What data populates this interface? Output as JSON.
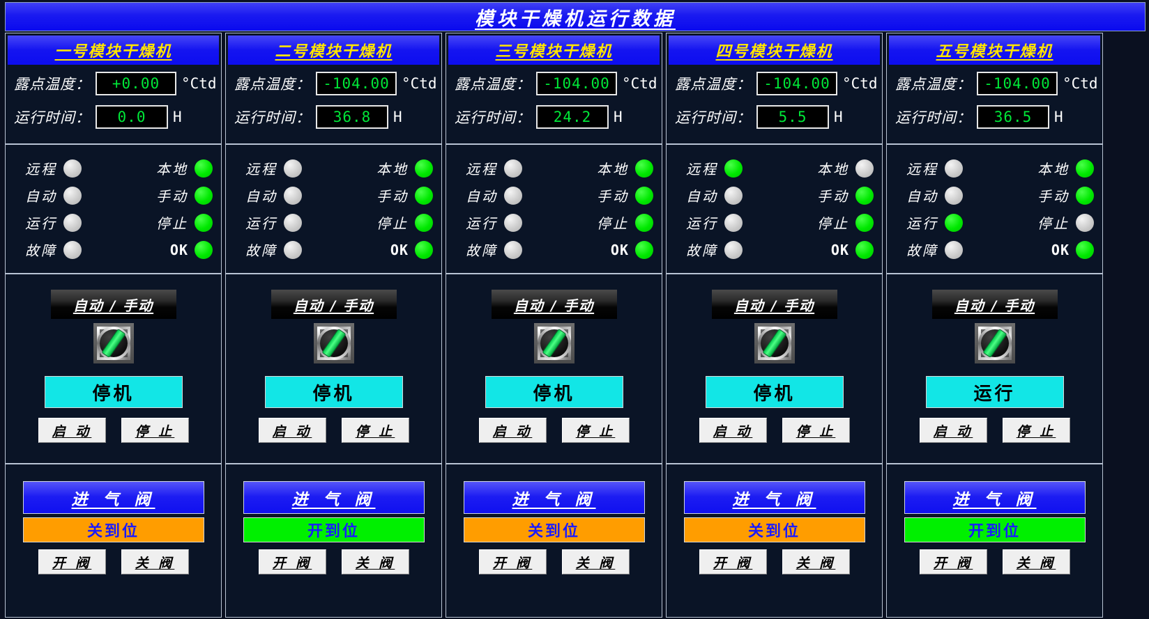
{
  "header": {
    "title": "模块干燥机运行数据"
  },
  "labels": {
    "dewpoint": "露点温度：",
    "dewpoint_unit": "°Ctd",
    "runtime": "运行时间：",
    "runtime_unit": "H",
    "remote": "远程",
    "local": "本地",
    "auto": "自动",
    "manual": "手动",
    "running": "运行",
    "stopped": "停止",
    "fault": "故障",
    "ok": "OK",
    "auto_manual_plate": "自动 / 手动",
    "start_button": "启 动",
    "stop_button": "停 止",
    "valve_title": "进 气 阀",
    "valve_open_button": "开 阀",
    "valve_close_button": "关 阀"
  },
  "colors": {
    "title_bar_blue": "#1414f0",
    "panel_header_yellow": "#ffe400",
    "led_on_green": "#00e800",
    "led_off_gray": "#c9c9c9",
    "readout_green": "#00e838",
    "run_state_cyan": "#12e6e6",
    "valve_closed_orange": "#ff9d00",
    "valve_open_green": "#00f000",
    "valve_state_text_blue": "#1a1aff",
    "background": "#0a1020"
  },
  "dryers": [
    {
      "name": "一号模块干燥机",
      "dewpoint": "+0.00",
      "runtime": "0.0",
      "leds": {
        "remote": false,
        "local": true,
        "auto": false,
        "manual": true,
        "running": false,
        "stopped": true,
        "fault": false,
        "ok": true
      },
      "run_state": "停机",
      "valve_state": "关到位",
      "valve_state_color": "#ff9d00"
    },
    {
      "name": "二号模块干燥机",
      "dewpoint": "-104.00",
      "runtime": "36.8",
      "leds": {
        "remote": false,
        "local": true,
        "auto": false,
        "manual": true,
        "running": false,
        "stopped": true,
        "fault": false,
        "ok": true
      },
      "run_state": "停机",
      "valve_state": "开到位",
      "valve_state_color": "#00f000"
    },
    {
      "name": "三号模块干燥机",
      "dewpoint": "-104.00",
      "runtime": "24.2",
      "leds": {
        "remote": false,
        "local": true,
        "auto": false,
        "manual": true,
        "running": false,
        "stopped": true,
        "fault": false,
        "ok": true
      },
      "run_state": "停机",
      "valve_state": "关到位",
      "valve_state_color": "#ff9d00"
    },
    {
      "name": "四号模块干燥机",
      "dewpoint": "-104.00",
      "runtime": "5.5",
      "leds": {
        "remote": true,
        "local": false,
        "auto": false,
        "manual": true,
        "running": false,
        "stopped": true,
        "fault": false,
        "ok": true
      },
      "run_state": "停机",
      "valve_state": "关到位",
      "valve_state_color": "#ff9d00"
    },
    {
      "name": "五号模块干燥机",
      "dewpoint": "-104.00",
      "runtime": "36.5",
      "leds": {
        "remote": false,
        "local": true,
        "auto": false,
        "manual": true,
        "running": true,
        "stopped": false,
        "fault": false,
        "ok": true
      },
      "run_state": "运行",
      "valve_state": "开到位",
      "valve_state_color": "#00f000"
    }
  ]
}
